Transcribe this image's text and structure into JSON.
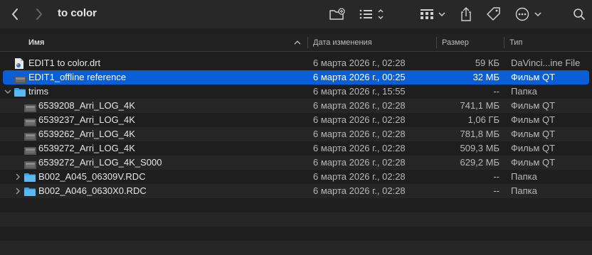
{
  "window": {
    "title": "to color"
  },
  "toolbar": {
    "back_icon": "chevron-left-icon",
    "forward_icon": "chevron-right-icon",
    "new_folder_icon": "new-folder-icon",
    "list_view_icon": "list-view-icon",
    "group_icon": "grid-group-icon",
    "share_icon": "share-icon",
    "tag_icon": "tag-icon",
    "more_icon": "ellipsis-circle-icon",
    "search_icon": "search-icon"
  },
  "columns": {
    "name": "Имя",
    "date": "Дата изменения",
    "size": "Размер",
    "kind": "Тип"
  },
  "files": [
    {
      "name": "EDIT1 to color.drt",
      "date": "6 марта 2026 г., 02:28",
      "size": "59 КБ",
      "kind": "DaVinci...ine File",
      "icon": "drt-file-icon",
      "indent": 0,
      "expand": ""
    },
    {
      "name": "EDIT1_offline reference",
      "date": "6 марта 2026 г., 00:25",
      "size": "32 МБ",
      "kind": "Фильм QT",
      "icon": "video-file-icon",
      "indent": 0,
      "expand": "",
      "selected": true
    },
    {
      "name": "trims",
      "date": "6 марта 2026 г., 15:55",
      "size": "--",
      "kind": "Папка",
      "icon": "folder-icon",
      "indent": 0,
      "expand": "open"
    },
    {
      "name": "6539208_Arri_LOG_4K",
      "date": "6 марта 2026 г., 02:28",
      "size": "741,1 МБ",
      "kind": "Фильм QT",
      "icon": "video-file-icon",
      "indent": 1,
      "expand": ""
    },
    {
      "name": "6539237_Arri_LOG_4K",
      "date": "6 марта 2026 г., 02:28",
      "size": "1,06 ГБ",
      "kind": "Фильм QT",
      "icon": "video-file-icon",
      "indent": 1,
      "expand": ""
    },
    {
      "name": "6539262_Arri_LOG_4K",
      "date": "6 марта 2026 г., 02:28",
      "size": "781,8 МБ",
      "kind": "Фильм QT",
      "icon": "video-file-icon",
      "indent": 1,
      "expand": ""
    },
    {
      "name": "6539272_Arri_LOG_4K",
      "date": "6 марта 2026 г., 02:28",
      "size": "509,3 МБ",
      "kind": "Фильм QT",
      "icon": "video-file-icon",
      "indent": 1,
      "expand": ""
    },
    {
      "name": "6539272_Arri_LOG_4K_S000",
      "date": "6 марта 2026 г., 02:28",
      "size": "629,2 МБ",
      "kind": "Фильм QT",
      "icon": "video-file-icon",
      "indent": 1,
      "expand": ""
    },
    {
      "name": "B002_A045_06309V.RDC",
      "date": "6 марта 2026 г., 02:28",
      "size": "--",
      "kind": "Папка",
      "icon": "folder-icon",
      "indent": 1,
      "expand": "closed"
    },
    {
      "name": "B002_A046_0630X0.RDC",
      "date": "6 марта 2026 г., 02:28",
      "size": "--",
      "kind": "Папка",
      "icon": "folder-icon",
      "indent": 1,
      "expand": "closed"
    }
  ],
  "colors": {
    "selection": "#0a5fd6",
    "folder": "#3aa6ea",
    "background": "#1e1e1e",
    "toolbar": "#282828"
  }
}
